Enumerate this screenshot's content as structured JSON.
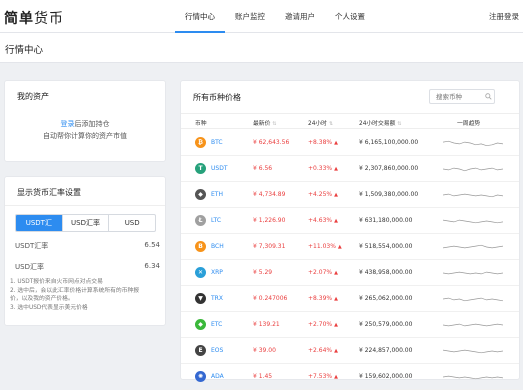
{
  "header": {
    "logo_bold": "简单",
    "logo_light": "货币",
    "nav": [
      "行情中心",
      "账户监控",
      "邀请用户",
      "个人设置"
    ],
    "login": "注册登录"
  },
  "breadcrumb": {
    "title": "行情中心"
  },
  "assets": {
    "title": "我的资产",
    "login_link": "登录",
    "login_suffix": "后添加持仓",
    "desc": "自动帮你计算你的资产市值"
  },
  "rates": {
    "title": "显示货币汇率设置",
    "tabs": [
      "USDT汇",
      "USD汇率",
      "USD"
    ],
    "active_tab": 0,
    "rows": [
      {
        "label": "USDT汇率",
        "value": "6.54"
      },
      {
        "label": "USD汇率",
        "value": "6.34"
      }
    ],
    "notes": [
      "1. USDT报价来自火币网点对点交易",
      "2. 选中后，会以此汇率价格计算系统所有的币种报",
      "价，以及我的资产价格。",
      "3. 选中USD代表显示美元价格"
    ]
  },
  "market": {
    "title": "所有币种价格",
    "search_placeholder": "搜索币种",
    "columns": [
      "币种",
      "最新价",
      "24小时",
      "24小时交易额",
      "一周趋势"
    ],
    "rows": [
      {
        "symbol": "BTC",
        "price": "¥ 62,643.56",
        "change": "+8.38%",
        "volume": "¥ 6,165,100,000.00",
        "color": "#f7931a",
        "glyph": "₿",
        "trend": [
          0.55,
          0.6,
          0.5,
          0.45,
          0.55,
          0.5,
          0.4,
          0.45,
          0.35,
          0.4,
          0.5,
          0.45
        ]
      },
      {
        "symbol": "USDT",
        "price": "¥ 6.56",
        "change": "+0.33%",
        "volume": "¥ 2,307,860,000.00",
        "color": "#26a17b",
        "glyph": "T",
        "trend": [
          0.5,
          0.45,
          0.55,
          0.5,
          0.4,
          0.5,
          0.55,
          0.45,
          0.5,
          0.55,
          0.45,
          0.5
        ]
      },
      {
        "symbol": "ETH",
        "price": "¥ 4,734.89",
        "change": "+4.25%",
        "volume": "¥ 1,509,380,000.00",
        "color": "#555555",
        "glyph": "◆",
        "trend": [
          0.5,
          0.55,
          0.45,
          0.5,
          0.55,
          0.5,
          0.45,
          0.5,
          0.45,
          0.4,
          0.5,
          0.45
        ]
      },
      {
        "symbol": "LTC",
        "price": "¥ 1,226.90",
        "change": "+4.63%",
        "volume": "¥ 631,180,000.00",
        "color": "#a0a0a0",
        "glyph": "Ł",
        "trend": [
          0.55,
          0.5,
          0.45,
          0.55,
          0.5,
          0.45,
          0.4,
          0.45,
          0.5,
          0.45,
          0.4,
          0.45
        ]
      },
      {
        "symbol": "BCH",
        "price": "¥ 7,309.31",
        "change": "+11.03%",
        "volume": "¥ 518,554,000.00",
        "color": "#f7931a",
        "glyph": "B",
        "trend": [
          0.45,
          0.5,
          0.55,
          0.5,
          0.45,
          0.5,
          0.55,
          0.6,
          0.5,
          0.45,
          0.5,
          0.55
        ]
      },
      {
        "symbol": "XRP",
        "price": "¥ 5.29",
        "change": "+2.07%",
        "volume": "¥ 438,958,000.00",
        "color": "#2a9fd8",
        "glyph": "✕",
        "trend": [
          0.5,
          0.45,
          0.5,
          0.55,
          0.5,
          0.45,
          0.5,
          0.45,
          0.55,
          0.5,
          0.45,
          0.5
        ]
      },
      {
        "symbol": "TRX",
        "price": "¥ 0.247006",
        "change": "+8.39%",
        "volume": "¥ 265,062,000.00",
        "color": "#333333",
        "glyph": "▼",
        "trend": [
          0.5,
          0.55,
          0.45,
          0.5,
          0.4,
          0.45,
          0.5,
          0.55,
          0.45,
          0.5,
          0.45,
          0.4
        ]
      },
      {
        "symbol": "ETC",
        "price": "¥ 139.21",
        "change": "+2.70%",
        "volume": "¥ 250,579,000.00",
        "color": "#3ab83a",
        "glyph": "◆",
        "trend": [
          0.5,
          0.45,
          0.5,
          0.55,
          0.45,
          0.5,
          0.55,
          0.5,
          0.45,
          0.5,
          0.55,
          0.5
        ]
      },
      {
        "symbol": "EOS",
        "price": "¥ 39.00",
        "change": "+2.64%",
        "volume": "¥ 224,857,000.00",
        "color": "#444444",
        "glyph": "E",
        "trend": [
          0.55,
          0.5,
          0.45,
          0.5,
          0.55,
          0.5,
          0.45,
          0.4,
          0.45,
          0.5,
          0.45,
          0.5
        ]
      },
      {
        "symbol": "ADA",
        "price": "¥ 1.45",
        "change": "+7.53%",
        "volume": "¥ 159,602,000.00",
        "color": "#3468d1",
        "glyph": "✺",
        "trend": [
          0.5,
          0.55,
          0.5,
          0.45,
          0.5,
          0.45,
          0.4,
          0.45,
          0.5,
          0.45,
          0.5,
          0.45
        ]
      }
    ]
  }
}
